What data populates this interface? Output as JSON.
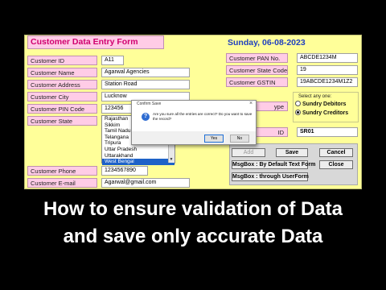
{
  "form": {
    "title": "Customer Data Entry Form",
    "date": "Sunday, 06-08-2023",
    "left_fields": [
      {
        "label": "Customer ID",
        "value": "A11"
      },
      {
        "label": "Customer Name",
        "value": "Agarwal Agencies"
      },
      {
        "label": "Customer Address",
        "value": "Station Road"
      },
      {
        "label": "Customer City",
        "value": "Lucknow"
      },
      {
        "label": "Customer PIN Code",
        "value": "123456"
      },
      {
        "label": "Customer State",
        "value": ""
      },
      {
        "label": "Customer Phone",
        "value": "1234567890"
      },
      {
        "label": "Customer E-mail",
        "value": "Agarwal@gmail.com"
      }
    ],
    "state_options": [
      "Rajasthan",
      "Sikkim",
      "Tamil Nadu",
      "Telangana",
      "Tripura",
      "Uttar Pradesh",
      "Uttarakhand",
      "West Bengal"
    ],
    "state_selected": "West Bengal",
    "right_fields": [
      {
        "label": "Customer PAN No.",
        "value": "ABCDE1234M"
      },
      {
        "label": "Customer State Code",
        "value": "19"
      },
      {
        "label": "Customer GSTIN",
        "value": "19ABCDE1234M1Z2"
      }
    ],
    "partial_labels": {
      "type_label": "ype",
      "id_label": "ID"
    },
    "sr_value": "SR01",
    "options": {
      "title": "Select any one:",
      "items": [
        {
          "label": "Sundry Debitors",
          "selected": false
        },
        {
          "label": "Sundry Creditors",
          "selected": true
        }
      ]
    },
    "buttons": {
      "add": "Add",
      "save": "Save",
      "cancel": "Cancel",
      "close": "Close",
      "msgbox_text_form": "MsgBox : By Default Text Form",
      "msgbox_userform": "MsgBox : through UserForm"
    }
  },
  "dialog": {
    "title": "Confirm Save",
    "close": "×",
    "icon": "question-icon",
    "message": "Are you sure all the entries are correct? Do you want to save the record?",
    "yes": "Yes",
    "no": "No"
  },
  "caption": {
    "line1": "How to ensure validation of Data",
    "line2": "and save only accurate Data"
  }
}
